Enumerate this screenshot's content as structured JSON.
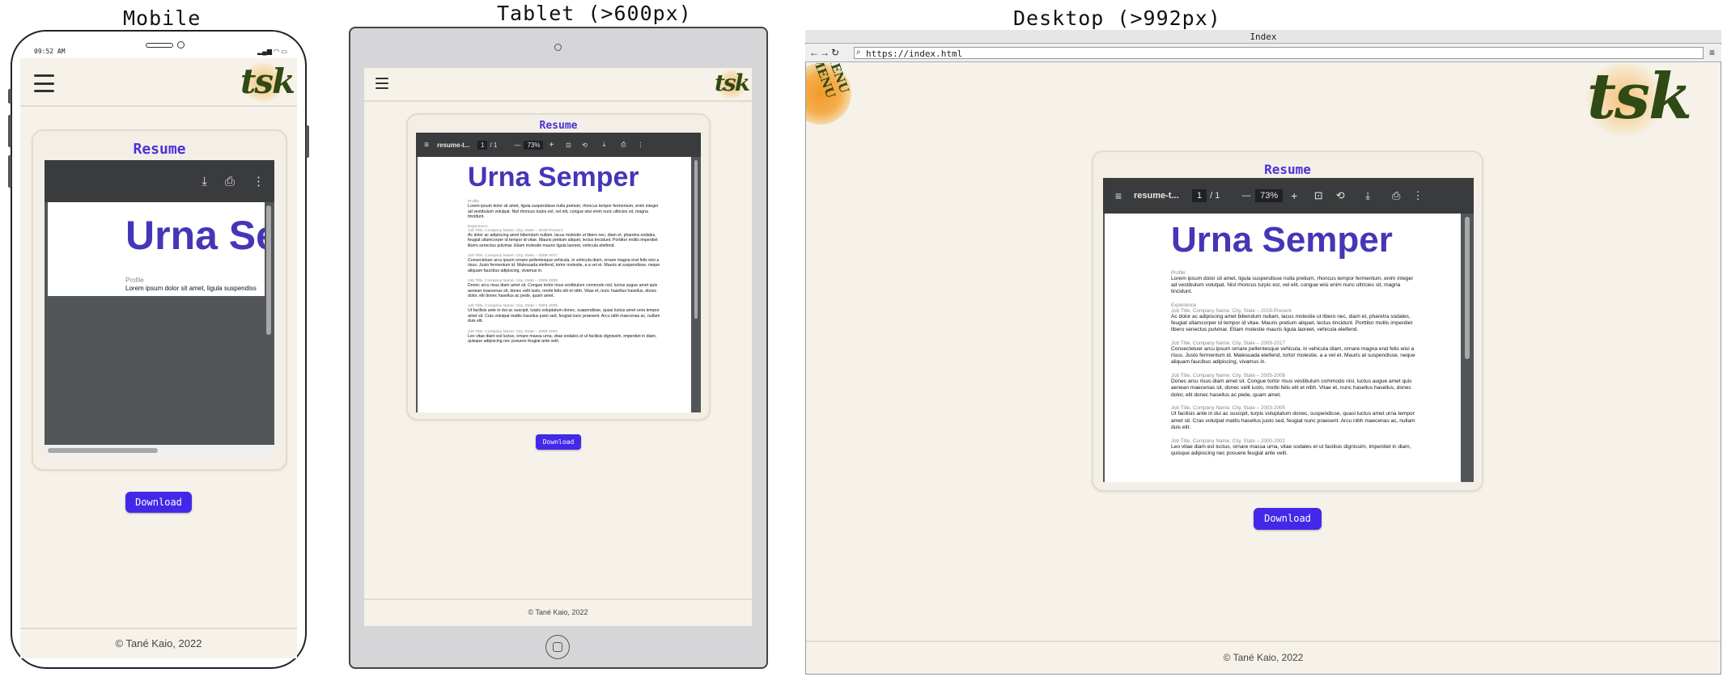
{
  "labels": {
    "mobile": "Mobile",
    "tablet": "Tablet (>600px)",
    "desktop": "Desktop (>992px)"
  },
  "mobile": {
    "status_time": "09:52 AM",
    "logo": "tsk",
    "card_title": "Resume",
    "pdf_heading": "Urna Se",
    "pdf_profile_label": "Profile",
    "pdf_profile_text": "Lorem ipsum dolor sit amet, ligula suspendiss",
    "download_label": "Download",
    "footer": "© Tané Kaio, 2022"
  },
  "tablet": {
    "logo": "tsk",
    "card_title": "Resume",
    "pdf_filename": "resume-t...",
    "pdf_page": "1",
    "pdf_pages": "/ 1",
    "pdf_zoom": "73%",
    "pdf_heading": "Urna Semper",
    "download_label": "Download",
    "footer": "© Tané Kaio, 2022"
  },
  "desktop": {
    "window_title": "Index",
    "url": "https://index.html",
    "menu_badge": "MENU MENU",
    "logo": "tsk",
    "card_title": "Resume",
    "pdf_filename": "resume-t...",
    "pdf_page": "1",
    "pdf_pages": "/ 1",
    "pdf_zoom": "73%",
    "pdf_heading": "Urna Semper",
    "download_label": "Download",
    "footer": "© Tané Kaio, 2022"
  },
  "resume": {
    "profile_label": "Profile",
    "profile_text": "Lorem ipsum dolor sit amet, ligula suspendisse nulla pretium, rhoncus tempor fermentum, enim integer ad vestibulum volutpat. Nisl rhoncus turpis est, vel elit, congue wisi enim nunc ultricies sit, magna tincidunt.",
    "experience_label": "Experience",
    "jobs": [
      {
        "title": "Job Title, Company Name; City, State – 2019-Present",
        "text": "Ac dolor ac adipiscing amet bibendum nullam, lacus molestie ut libero nec, diam et, pharetra sodales, feugiat ullamcorper id tempor id vitae. Mauris pretium aliquet, lectus tincidunt. Porttitor mollis imperdiet libero senectus pulvinar. Etiam molestie mauris ligula laoreet, vehicula eleifend."
      },
      {
        "title": "Job Title, Company Name; City, State – 2009-2017",
        "text": "Consectetuer arcu ipsum ornare pellentesque vehicula, in vehicula diam, ornare magna erat felis wisi a risus. Justo fermentum id. Malesuada eleifend, tortor molestie, a a vel et. Mauris at suspendisse, neque aliquam faucibus adipiscing, vivamus in."
      },
      {
        "title": "Job Title, Company Name; City, State – 2005-2008",
        "text": "Donec arcu risus diam amet sit. Congue tortor risus vestibulum commodo nisl, luctus augue amet quis aenean maecenas sit, donec velit iusto, morbi felis elit et nibh. Vitae et, nunc hasellus hasellus, donec dolor, elit donec hasellus ac pede, quam amet."
      },
      {
        "title": "Job Title, Company Name; City, State – 2003-2005",
        "text": "Ut facilisis ante in dui ac suscipit, turpis voluptatum donec, suspendisse, quasi luctus amet urna tempor amet sit. Cras volutpat mattis hasellus justo sed, feugiat nunc praesent. Arcu nibh maecenas ac, nullam duis elit."
      },
      {
        "title": "Job Title, Company Name; City, State – 2000-2002",
        "text": "Leo vitae diam est luctus, ornare massa urna, vitae sodales et ut facilisis dignissim, imperdiet in diam, quisque adipiscing nec posuere feugiat ante velit."
      }
    ]
  }
}
